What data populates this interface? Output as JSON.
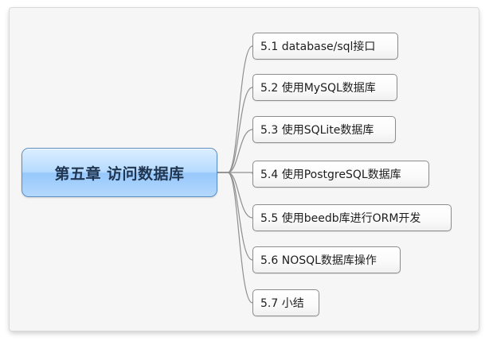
{
  "root_topic": {
    "label": "第五章 访问数据库"
  },
  "sub_topics": [
    {
      "label": "5.1 database/sql接口"
    },
    {
      "label": "5.2 使用MySQL数据库"
    },
    {
      "label": "5.3 使用SQLite数据库"
    },
    {
      "label": "5.4 使用PostgreSQL数据库"
    },
    {
      "label": "5.5 使用beedb库进行ORM开发"
    },
    {
      "label": "5.6 NOSQL数据库操作"
    },
    {
      "label": "5.7 小结"
    }
  ],
  "colors": {
    "root_fill": "#b7dbff",
    "root_border": "#5b8fc4",
    "connector": "#8f8f8f",
    "topic_border": "#8c8c8c"
  }
}
